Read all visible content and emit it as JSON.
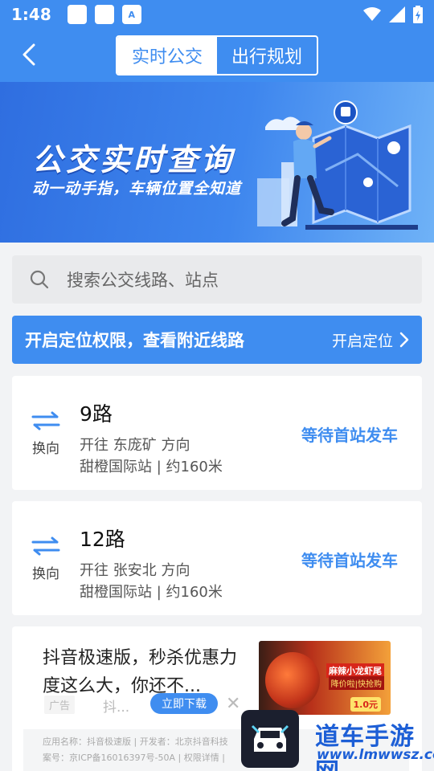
{
  "status_bar": {
    "time": "1:48"
  },
  "header": {
    "tabs": [
      {
        "label": "实时公交",
        "active": true
      },
      {
        "label": "出行规划",
        "active": false
      }
    ]
  },
  "banner": {
    "title": "公交实时查询",
    "subtitle": "动一动手指，车辆位置全知道"
  },
  "search": {
    "placeholder": "搜索公交线路、站点"
  },
  "location": {
    "message": "开启定位权限，查看附近线路",
    "button": "开启定位"
  },
  "routes": [
    {
      "swap_label": "换向",
      "name": "9路",
      "direction": "开往 东庞矿 方向",
      "stop": "甜橙国际站 | 约160米",
      "status": "等待首站发车"
    },
    {
      "swap_label": "换向",
      "name": "12路",
      "direction": "开往 张安北 方向",
      "stop": "甜橙国际站 | 约160米",
      "status": "等待首站发车"
    }
  ],
  "ad": {
    "title": "抖音极速版，秒杀优惠力度这么大，你还不...",
    "tag": "广告",
    "brand": "抖...",
    "download": "立即下载",
    "close": "✕",
    "image_text1": "麻辣小龙虾尾",
    "image_text2": "降价啦|快抢购",
    "image_price": "1.0元",
    "info_line1": "应用名称：抖音极速版 | 开发者：北京抖音科技",
    "info_line2": "案号：京ICP备16016397号-50A | 权限详情 |"
  },
  "watermark": {
    "name": "道车手游网",
    "url": "www.lmwwsz.com"
  },
  "colors": {
    "primary": "#3f8df0",
    "card_bg": "#ffffff",
    "page_bg": "#f2f3f5"
  }
}
